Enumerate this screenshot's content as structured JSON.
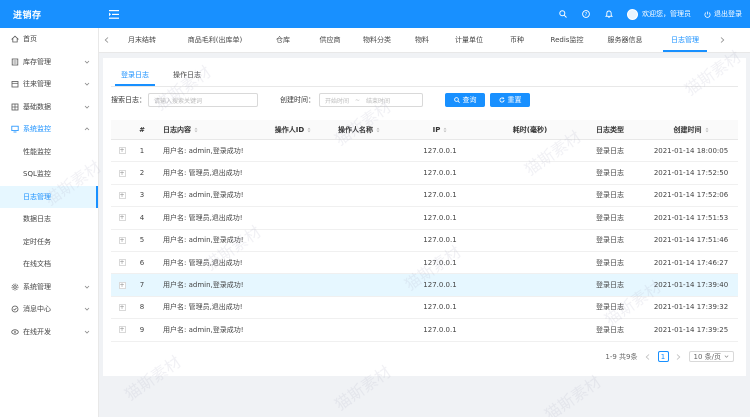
{
  "app": {
    "logo": "进销存"
  },
  "header": {
    "user_label": "欢迎您，管理员",
    "logout_label": "退出登录"
  },
  "sidebar": {
    "items": [
      {
        "label": "首页",
        "icon": "home-icon"
      },
      {
        "label": "库存管理",
        "icon": "inventory-icon"
      },
      {
        "label": "往来管理",
        "icon": "contacts-icon"
      },
      {
        "label": "基础数据",
        "icon": "database-icon"
      },
      {
        "label": "系统监控",
        "icon": "monitor-icon"
      }
    ],
    "subitems": [
      {
        "label": "性能监控"
      },
      {
        "label": "SQL监控"
      },
      {
        "label": "日志管理"
      },
      {
        "label": "数据日志"
      },
      {
        "label": "定时任务"
      },
      {
        "label": "在线文档"
      }
    ],
    "bottom_items": [
      {
        "label": "系统管理",
        "icon": "settings-icon"
      },
      {
        "label": "消息中心",
        "icon": "message-icon"
      },
      {
        "label": "在线开发",
        "icon": "develop-icon"
      }
    ]
  },
  "tabs": [
    {
      "label": "月末结转"
    },
    {
      "label": "商品毛利(出库单)"
    },
    {
      "label": "仓库"
    },
    {
      "label": "供应商"
    },
    {
      "label": "物料分类"
    },
    {
      "label": "物料"
    },
    {
      "label": "计量单位"
    },
    {
      "label": "币种"
    },
    {
      "label": "Redis监控"
    },
    {
      "label": "服务器信息"
    },
    {
      "label": "日志管理"
    }
  ],
  "subtabs": [
    {
      "label": "登录日志"
    },
    {
      "label": "操作日志"
    }
  ],
  "search": {
    "keyword_label": "搜索日志：",
    "keyword_placeholder": "请输入搜索关键词",
    "time_label": "创建时间：",
    "start_placeholder": "开始时间",
    "range_sep": "~",
    "end_placeholder": "结束时间",
    "search_button": "查询",
    "reset_button": "重置"
  },
  "table": {
    "headers": {
      "no": "#",
      "content": "日志内容",
      "uid": "操作人ID",
      "uname": "操作人名称",
      "ip": "IP",
      "cost": "耗时(毫秒)",
      "type": "日志类型",
      "created": "创建时间"
    },
    "rows": [
      {
        "no": "1",
        "content": "用户名: admin,登录成功!",
        "uid": "",
        "uname": "",
        "ip": "127.0.0.1",
        "cost": "",
        "type": "登录日志",
        "created": "2021-01-14 18:00:05"
      },
      {
        "no": "2",
        "content": "用户名: 管理员,退出成功!",
        "uid": "",
        "uname": "",
        "ip": "127.0.0.1",
        "cost": "",
        "type": "登录日志",
        "created": "2021-01-14 17:52:50"
      },
      {
        "no": "3",
        "content": "用户名: admin,登录成功!",
        "uid": "",
        "uname": "",
        "ip": "127.0.0.1",
        "cost": "",
        "type": "登录日志",
        "created": "2021-01-14 17:52:06"
      },
      {
        "no": "4",
        "content": "用户名: 管理员,退出成功!",
        "uid": "",
        "uname": "",
        "ip": "127.0.0.1",
        "cost": "",
        "type": "登录日志",
        "created": "2021-01-14 17:51:53"
      },
      {
        "no": "5",
        "content": "用户名: admin,登录成功!",
        "uid": "",
        "uname": "",
        "ip": "127.0.0.1",
        "cost": "",
        "type": "登录日志",
        "created": "2021-01-14 17:51:46"
      },
      {
        "no": "6",
        "content": "用户名: 管理员,退出成功!",
        "uid": "",
        "uname": "",
        "ip": "127.0.0.1",
        "cost": "",
        "type": "登录日志",
        "created": "2021-01-14 17:46:27"
      },
      {
        "no": "7",
        "content": "用户名: admin,登录成功!",
        "uid": "",
        "uname": "",
        "ip": "127.0.0.1",
        "cost": "",
        "type": "登录日志",
        "created": "2021-01-14 17:39:40"
      },
      {
        "no": "8",
        "content": "用户名: 管理员,退出成功!",
        "uid": "",
        "uname": "",
        "ip": "127.0.0.1",
        "cost": "",
        "type": "登录日志",
        "created": "2021-01-14 17:39:32"
      },
      {
        "no": "9",
        "content": "用户名: admin,登录成功!",
        "uid": "",
        "uname": "",
        "ip": "127.0.0.1",
        "cost": "",
        "type": "登录日志",
        "created": "2021-01-14 17:39:25"
      }
    ]
  },
  "pagination": {
    "summary": "1-9 共9条",
    "current": "1",
    "page_size": "10 条/页"
  },
  "watermark": "猫斯素材",
  "colors": {
    "primary": "#1890ff",
    "highlight_row": "#e6f7ff"
  }
}
